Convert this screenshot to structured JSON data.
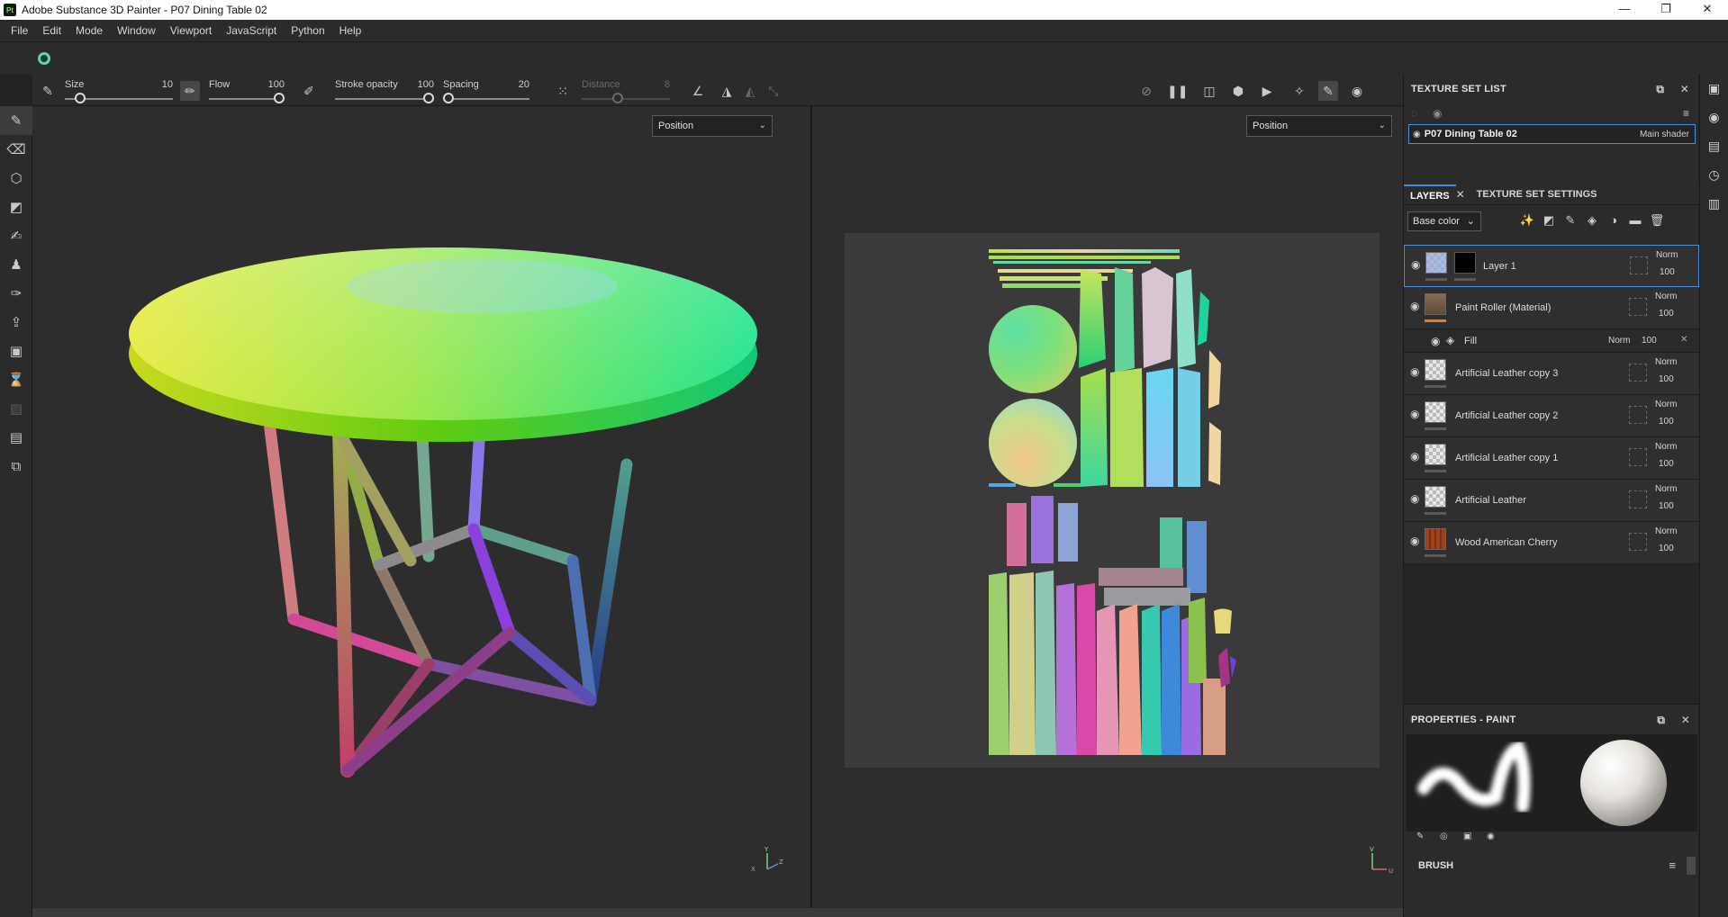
{
  "window": {
    "app_logo": "Pt",
    "title": "Adobe Substance 3D Painter - P07 Dining Table 02",
    "minimize": "—",
    "maximize": "❐",
    "close": "✕"
  },
  "menu": [
    "File",
    "Edit",
    "Mode",
    "Window",
    "Viewport",
    "JavaScript",
    "Python",
    "Help"
  ],
  "tool_options": {
    "size": {
      "label": "Size",
      "value": "10",
      "fraction": 0.1
    },
    "flow": {
      "label": "Flow",
      "value": "100",
      "fraction": 1.0
    },
    "stroke_opacity": {
      "label": "Stroke opacity",
      "value": "100",
      "fraction": 1.0
    },
    "spacing": {
      "label": "Spacing",
      "value": "20",
      "fraction": 0.0
    },
    "distance": {
      "label": "Distance",
      "value": "8",
      "fraction": 0.4,
      "enabled": false
    }
  },
  "viewport3d": {
    "mode_select": "Position",
    "gizmo": "gizmo-axis-icon"
  },
  "viewport2d": {
    "mode_select": "Position",
    "gizmo": "gizmo-axis-icon"
  },
  "texture_set_list": {
    "header": "TEXTURE SET LIST",
    "item_name": "P07 Dining Table 02",
    "item_shader": "Main shader"
  },
  "layers_panel": {
    "tabs": [
      "LAYERS",
      "TEXTURE SET SETTINGS"
    ],
    "channel": "Base color",
    "layers": [
      {
        "name": "Layer 1",
        "blend": "Norm",
        "opacity": "100",
        "selected": true
      },
      {
        "name": "Paint Roller (Material)",
        "blend": "Norm",
        "opacity": "100"
      },
      {
        "name": "Artificial Leather copy 3",
        "blend": "Norm",
        "opacity": "100"
      },
      {
        "name": "Artificial Leather copy 2",
        "blend": "Norm",
        "opacity": "100"
      },
      {
        "name": "Artificial Leather copy 1",
        "blend": "Norm",
        "opacity": "100"
      },
      {
        "name": "Artificial Leather",
        "blend": "Norm",
        "opacity": "100"
      },
      {
        "name": "Wood American Cherry",
        "blend": "Norm",
        "opacity": "100"
      }
    ],
    "fill_sub": {
      "name": "Fill",
      "blend": "Norm",
      "opacity": "100"
    }
  },
  "properties": {
    "header": "PROPERTIES - PAINT",
    "brush_section": "BRUSH"
  },
  "colors": {
    "accent": "#4d8fd9",
    "panel_bg": "#2b2b2b",
    "viewport_bg": "#2d2d2d",
    "material_bar": "#e97a26"
  }
}
